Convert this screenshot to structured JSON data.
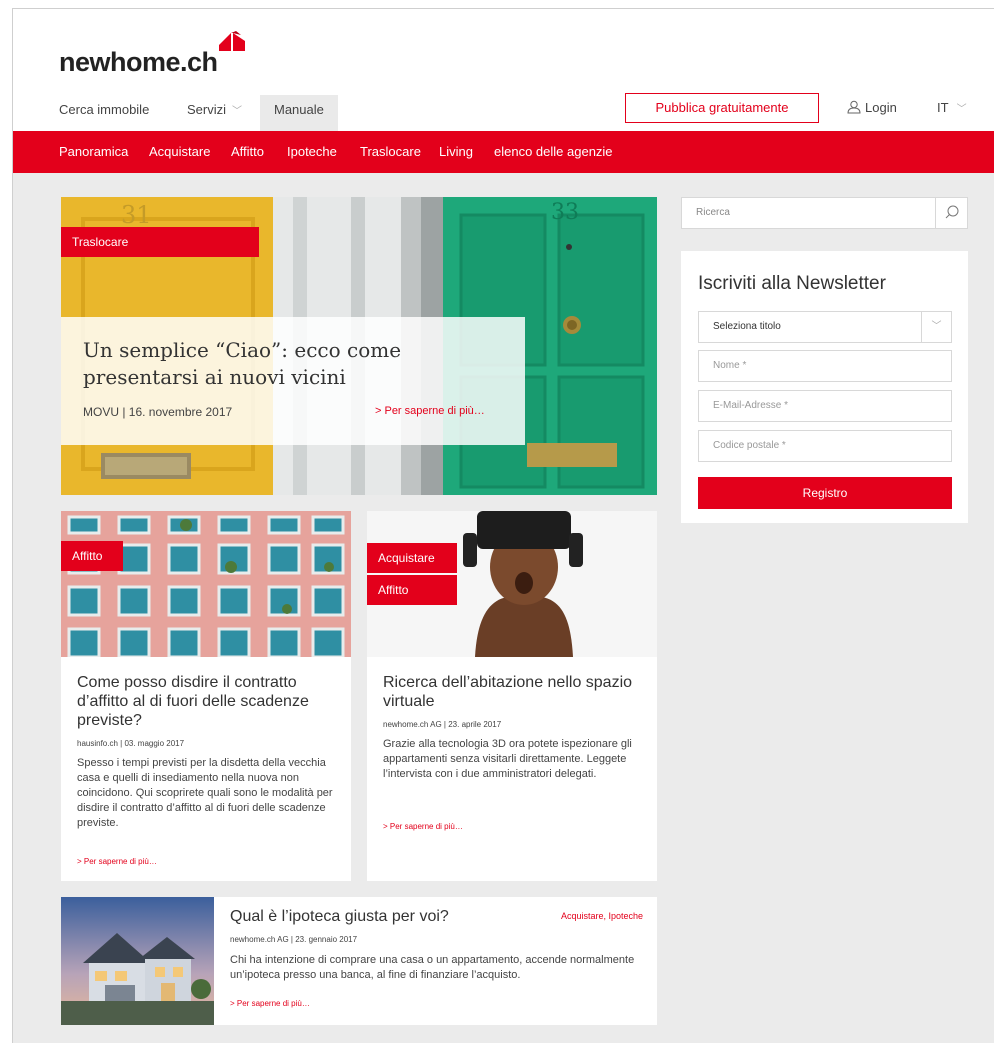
{
  "brand": {
    "logo_text": "newhome.ch",
    "accent": "#e3001b"
  },
  "mainnav": {
    "cerca": "Cerca immobile",
    "servizi": "Servizi",
    "manuale": "Manuale",
    "publish": "Pubblica gratuitamente",
    "login": "Login",
    "lang": "IT"
  },
  "subnav": [
    "Panoramica",
    "Acquistare",
    "Affitto",
    "Ipoteche",
    "Traslocare",
    "Living",
    "elenco delle agenzie"
  ],
  "hero": {
    "tag": "Traslocare",
    "title": "Un semplice “Ciao”: ecco come presentarsi ai nuovi vicini",
    "meta": "MOVU | 16. novembre 2017",
    "more": "> Per saperne di più…",
    "door_number_left": "31",
    "door_number_right": "33"
  },
  "card1": {
    "tag": "Affitto",
    "title": "Come posso disdire il contratto d’affitto al di fuori delle scadenze previste?",
    "meta": "hausinfo.ch | 03. maggio 2017",
    "text": "Spesso i tempi previsti per la disdetta della vecchia casa e quelli di insediamento nella nuova non coincidono. Qui scoprirete quali sono le modalità per disdire il contratto d’affitto al di fuori delle scadenze previste.",
    "more": "> Per saperne di più…"
  },
  "card2": {
    "tag1": "Acquistare",
    "tag2": "Affitto",
    "title": "Ricerca dell’abitazione nello spazio virtuale",
    "meta": "newhome.ch AG | 23. aprile 2017",
    "text": "Grazie alla tecnologia 3D ora potete ispezionare gli appartamenti senza visitarli direttamente. Leggete l’intervista con i due amministratori delegati.",
    "more": "> Per saperne di più…"
  },
  "card3": {
    "title": "Qual è l’ipoteca giusta per voi?",
    "tags": "Acquistare,  Ipoteche",
    "meta": "newhome.ch AG | 23. gennaio 2017",
    "text": "Chi ha intenzione di comprare una casa o un appartamento, accende normalmente un’ipoteca presso una banca, al fine di finanziare l’acquisto.",
    "more": "> Per saperne di più…"
  },
  "search": {
    "placeholder": "Ricerca",
    "icon": "search-icon"
  },
  "newsletter": {
    "title": "Iscriviti alla Newsletter",
    "select_title": "Seleziona titolo",
    "name": "Nome *",
    "email": "E-Mail-Adresse *",
    "zip": "Codice postale *",
    "submit": "Registro"
  }
}
